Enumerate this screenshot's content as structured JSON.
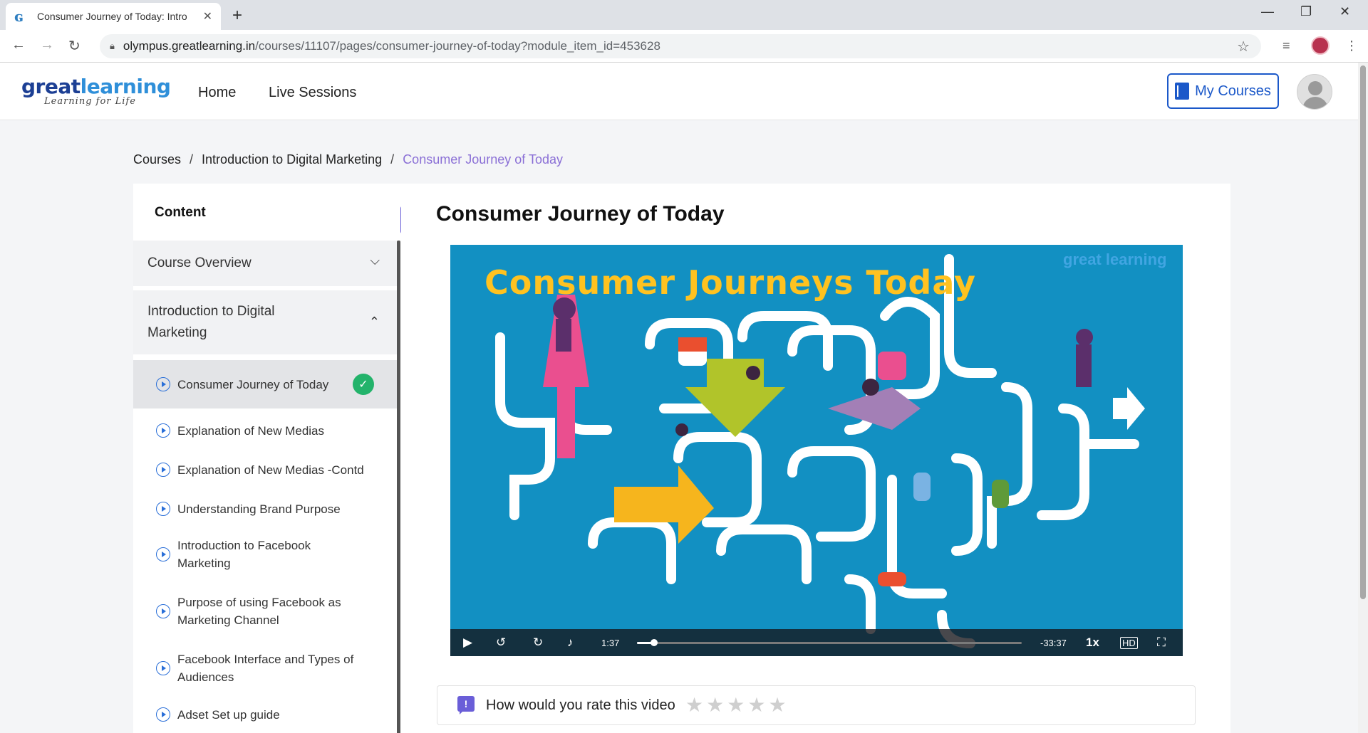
{
  "browser": {
    "tab_title": "Consumer Journey of Today: Intro",
    "favicon": "gl",
    "url_host": "olympus.greatlearning.in",
    "url_path": "/courses/11107/pages/consumer-journey-of-today?module_item_id=453628"
  },
  "header": {
    "logo_text_1": "great",
    "logo_text_2": "learning",
    "logo_tagline": "Learning for Life",
    "nav": [
      "Home",
      "Live Sessions"
    ],
    "my_courses": "My Courses"
  },
  "breadcrumb": {
    "items": [
      "Courses",
      "Introduction to Digital Marketing"
    ],
    "current": "Consumer Journey of Today",
    "separator": "/"
  },
  "sidebar": {
    "title": "Content",
    "sections": [
      {
        "label": "Course Overview",
        "expanded": false
      },
      {
        "label": "Introduction to Digital Marketing",
        "expanded": true
      }
    ],
    "lessons": [
      {
        "label": "Consumer Journey of Today",
        "active": true,
        "completed": true
      },
      {
        "label": "Explanation of New Medias",
        "active": false,
        "completed": false
      },
      {
        "label": "Explanation of New Medias -Contd",
        "active": false,
        "completed": false
      },
      {
        "label": "Understanding Brand Purpose",
        "active": false,
        "completed": false
      },
      {
        "label": "Introduction to Facebook Marketing",
        "active": false,
        "completed": false
      },
      {
        "label": "Purpose of using Facebook as Marketing Channel",
        "active": false,
        "completed": false
      },
      {
        "label": "Facebook Interface and Types of Audiences",
        "active": false,
        "completed": false
      },
      {
        "label": "Adset Set up guide",
        "active": false,
        "completed": false
      }
    ]
  },
  "main": {
    "lesson_title": "Consumer Journey of Today",
    "video": {
      "frame_title": "Consumer Journeys Today",
      "watermark": "great learning",
      "elapsed": "1:37",
      "remaining": "-33:37",
      "speed": "1x",
      "progress": 0.045
    },
    "rating": {
      "prompt": "How would you rate this video",
      "stars": 5,
      "selected": 0
    }
  },
  "colors": {
    "accent": "#6a5ed8",
    "link_blue": "#1b58c9",
    "breadcrumb_current": "#8a6fd6",
    "success": "#23b36b",
    "video_bg": "#1290c2",
    "video_title": "#ffc220"
  }
}
